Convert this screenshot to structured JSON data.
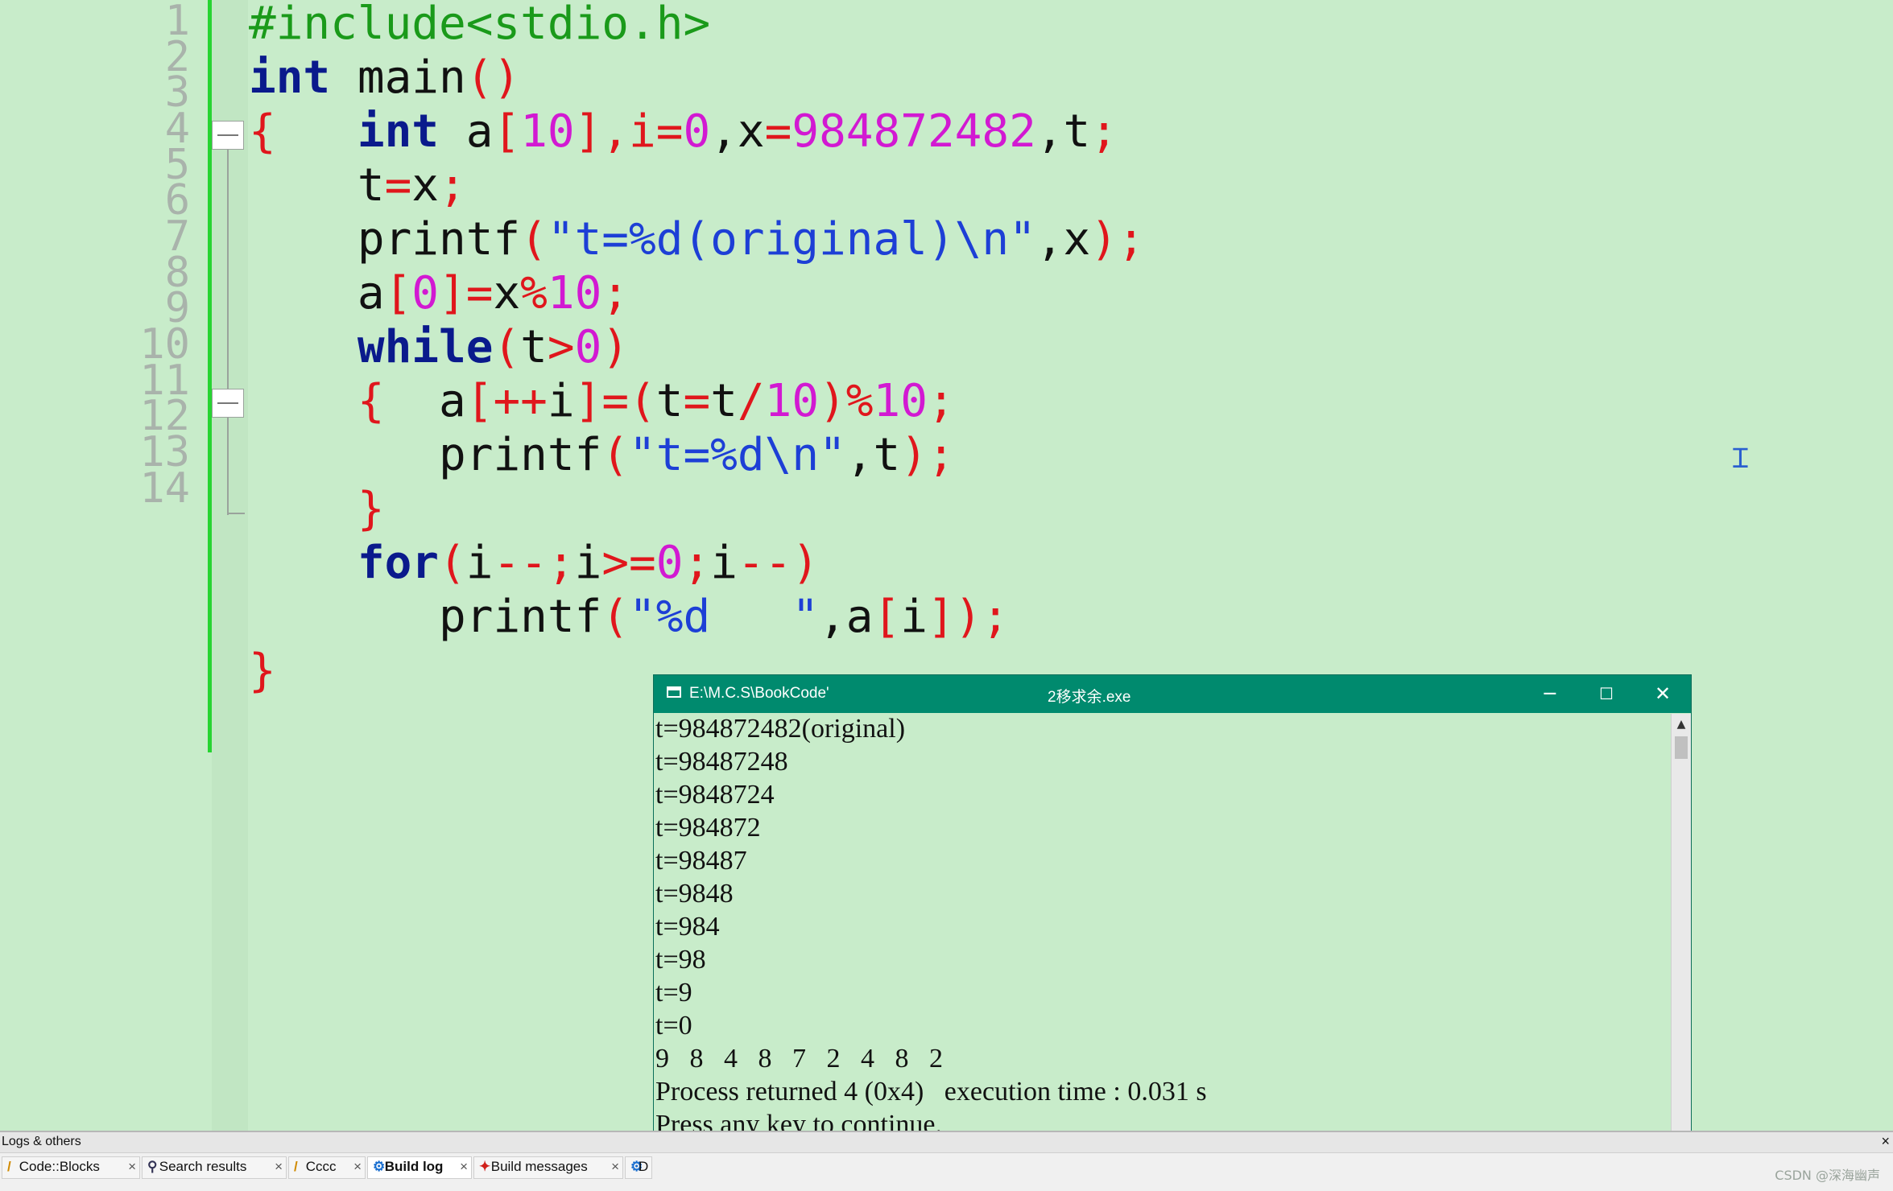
{
  "editor": {
    "line_numbers": [
      "1",
      "2",
      "3",
      "4",
      "5",
      "6",
      "7",
      "8",
      "9",
      "10",
      "11",
      "12",
      "13",
      "14"
    ]
  },
  "code": {
    "line1": {
      "pp": "#include<stdio.h>"
    },
    "line2": {
      "kw": "int",
      "rest": " main",
      "paren": "()"
    },
    "line3": {
      "brace": "{",
      "kw": "int",
      "t1": " a",
      "t2": "[",
      "t3": "10",
      "t4": "],i",
      "t5": "=",
      "t6": "0",
      "t7": ",x",
      "t8": "=",
      "t9": "984872482",
      "t10": ",t",
      "t11": ";"
    },
    "line4": {
      "t1": "t",
      "t2": "=",
      "t3": "x",
      "t4": ";"
    },
    "line5": {
      "t1": "printf",
      "t2": "(",
      "t3": "\"t=%d(original)\\n\"",
      "t4": ",x",
      "t5": ");"
    },
    "line6": {
      "t1": "a",
      "t2": "[",
      "t3": "0",
      "t4": "]=",
      "t5": "x",
      "t6": "%",
      "t7": "10",
      "t8": ";"
    },
    "line7": {
      "kw": "while",
      "t1": "(",
      "t2": "t",
      "t3": ">",
      "t4": "0",
      "t5": ")"
    },
    "line8": {
      "brace": "{",
      "t1": "a",
      "t2": "[++",
      "t3": "i",
      "t4": "]=(",
      "t5": "t",
      "t6": "=",
      "t7": "t",
      "t8": "/",
      "t9": "10",
      "t10": ")",
      "t11": "%",
      "t12": "10",
      "t13": ";"
    },
    "line9": {
      "t1": "printf",
      "t2": "(",
      "t3": "\"t=%d\\n\"",
      "t4": ",t",
      "t5": ");"
    },
    "line10": {
      "brace": "}"
    },
    "line11": {
      "kw": "for",
      "t1": "(",
      "t2": "i",
      "t3": "--;",
      "t4": "i",
      "t5": ">=",
      "t6": "0",
      "t7": ";",
      "t8": "i",
      "t9": "--)"
    },
    "line12": {
      "t1": "printf",
      "t2": "(",
      "t3": "\"%d   \"",
      "t4": ",a",
      "t5": "[",
      "t6": "i",
      "t7": "]);"
    },
    "line13": {
      "brace": "}"
    }
  },
  "console": {
    "title_path": "E:\\M.C.S\\BookCode'",
    "title_name": "2移求余.exe",
    "minimize": "─",
    "maximize": "☐",
    "close": "✕",
    "output_lines": [
      "t=984872482(original)",
      "t=98487248",
      "t=9848724",
      "t=984872",
      "t=98487",
      "t=9848",
      "t=984",
      "t=98",
      "t=9",
      "t=0",
      "9   8   4   8   7   2   4   8   2",
      "Process returned 4 (0x4)   execution time : 0.031 s",
      "Press any key to continue."
    ]
  },
  "logs": {
    "header": "Logs & others",
    "close": "×",
    "tabs": [
      {
        "label": "Code::Blocks",
        "icon": "script-icon"
      },
      {
        "label": "Search results",
        "icon": "search-icon"
      },
      {
        "label": "Cccc",
        "icon": "script-icon"
      },
      {
        "label": "Build log",
        "icon": "gear-icon"
      },
      {
        "label": "Build messages",
        "icon": "pin-icon"
      },
      {
        "label": "D",
        "icon": "gear-icon"
      }
    ],
    "tab_close": "×"
  },
  "watermark": "CSDN @深海幽声",
  "colors": {
    "background": "#c8ecca",
    "keyword": "#0a1a8c",
    "preprocessor": "#1a9a1a",
    "operator": "#e0161c",
    "number": "#d219d2",
    "string": "#1d3fd6",
    "console_title": "#008a6e",
    "change_bar": "#27d432"
  }
}
